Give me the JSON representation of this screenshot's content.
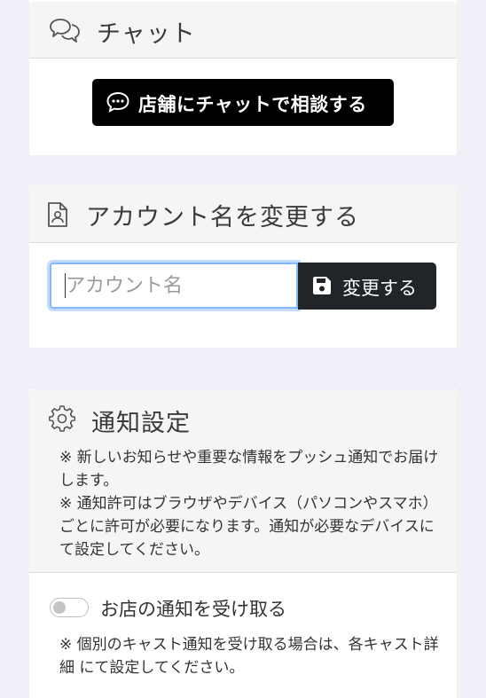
{
  "chat": {
    "title": "チャット",
    "header_icon": "chat-bubbles-icon",
    "button_label": "店舗にチャットで相談する",
    "button_icon": "comment-dots-icon"
  },
  "account": {
    "title": "アカウント名を変更する",
    "header_icon": "id-card-file-icon",
    "input_placeholder": "アカウント名",
    "input_value": "",
    "save_label": "変更する",
    "save_icon": "floppy-disk-icon"
  },
  "notification": {
    "title": "通知設定",
    "header_icon": "gear-icon",
    "note_lines": [
      "※ 新しいお知らせや重要な情報をプッシュ通知でお届けします。",
      "※ 通知許可はブラウザやデバイス（パソコンやスマホ）ごとに許可が必要になります。通知が必要なデバイスにて設定してください。"
    ],
    "toggle_label": "お店の通知を受け取る",
    "toggle_on": false,
    "cast_note": "※ 個別のキャスト通知を受け取る場合は、各キャスト詳細 にて設定してください。"
  },
  "colors": {
    "page_bg": "#f0f0f8",
    "header_bg": "#f5f5f5",
    "chat_button": "#000000",
    "save_button": "#212529",
    "focus_ring": "#86b7fe"
  }
}
